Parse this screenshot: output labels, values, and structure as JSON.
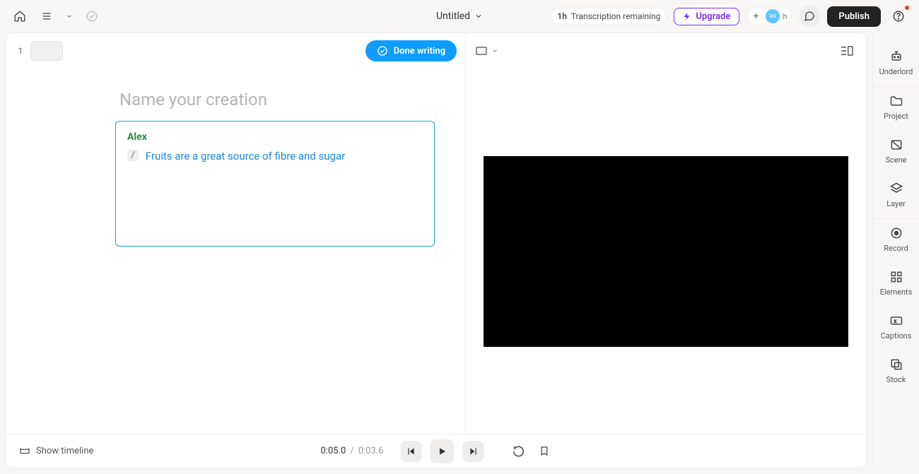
{
  "header": {
    "title": "Untitled",
    "transcription_strong": "1h",
    "transcription_label": "Transcription remaining",
    "upgrade_label": "Upgrade",
    "avatar_initials": "as",
    "avatar_suffix": "h",
    "publish_label": "Publish"
  },
  "rail": {
    "underlord": "Underlord",
    "project": "Project",
    "scene": "Scene",
    "layer": "Layer",
    "record": "Record",
    "elements": "Elements",
    "captions": "Captions",
    "stock": "Stock"
  },
  "editor": {
    "scene_number": "1",
    "done_label": "Done writing",
    "title_placeholder": "Name your creation",
    "speaker": "Alex",
    "marker": "/",
    "script_text": "Fruits are a great source of fibre and sugar"
  },
  "bottom": {
    "show_timeline": "Show timeline",
    "current": "0:05.0",
    "sep": "/",
    "duration": "0:03.6"
  }
}
